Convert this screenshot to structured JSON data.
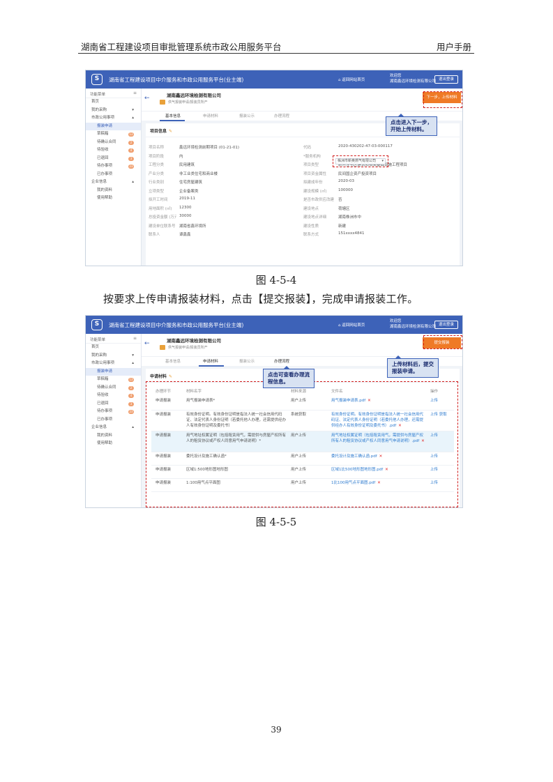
{
  "header": {
    "title": "湖南省工程建设项目审批管理系统市政公用服务平台",
    "manual": "用户手册"
  },
  "app": {
    "logo": "S",
    "title": "湖南省工程建设项目中介服务和市政公用服务平台(业主端)",
    "return_label": "返回网站首页",
    "welcome": "欢迎您",
    "user": "湖南鑫远环境检测有限公司",
    "exit_label": "退出登录",
    "menu_title": "功能菜单",
    "menu_icon": "≡",
    "company": "湖南鑫远环境检测有限公司",
    "company_sub": "供气报装申请/报装员所产",
    "back_arrow": "←"
  },
  "sidebar": {
    "items": [
      {
        "label": "首页",
        "type": "top"
      },
      {
        "label": "我的采购",
        "type": "top",
        "arrow": "▾"
      },
      {
        "label": "市政公用事项",
        "type": "top",
        "arrow": "▴"
      },
      {
        "label": "报装申请",
        "type": "sub",
        "active": true
      },
      {
        "label": "草稿箱",
        "type": "sub",
        "badge": "13"
      },
      {
        "label": "待确认合同",
        "type": "sub",
        "badge": "2"
      },
      {
        "label": "待验收",
        "type": "sub",
        "badge": "4"
      },
      {
        "label": "已退回",
        "type": "sub",
        "badge": "3"
      },
      {
        "label": "待办事项",
        "type": "sub",
        "badge": "23"
      },
      {
        "label": "已办事项",
        "type": "sub"
      },
      {
        "label": "企业信息",
        "type": "top",
        "arrow": "▴"
      },
      {
        "label": "我的资料",
        "type": "sub"
      },
      {
        "label": "使用帮助",
        "type": "sub"
      }
    ]
  },
  "shot1": {
    "button": "下一步，上传材料",
    "tabs": [
      "基本信息",
      "申请材料",
      "报装公示",
      "办理流程"
    ],
    "section": "项目信息",
    "pen": "✎",
    "left_fields": [
      {
        "label": "项目名称",
        "value": "鑫远环境检测前期项目 (01-21-01)"
      },
      {
        "label": "项目阶段",
        "value": "内"
      },
      {
        "label": "工程分类",
        "value": "民用建筑"
      },
      {
        "label": "产业分类",
        "value": "非工业类住宅和商业楼"
      },
      {
        "label": "行业类别",
        "value": "住宅房屋建筑"
      },
      {
        "label": "立项类型",
        "value": "企业备案类"
      },
      {
        "label": "拟开工时间",
        "value": "2019-11"
      },
      {
        "label": "用地面积 (㎡)",
        "value": "12300"
      },
      {
        "label": "总投资金额 (万元)",
        "value": "30000"
      },
      {
        "label": "建设单位联系号",
        "value": "湖南省鑫环境所"
      },
      {
        "label": "联系人",
        "value": "谭鑫鑫"
      }
    ],
    "right_fields": [
      {
        "label": "代码",
        "value": "2020-430202-47-03-000117"
      },
      {
        "label": "*服务机构",
        "value": "株洲市新奥燃气有限公司"
      },
      {
        "label": "项目类型",
        "value": "新兴住宅区建筑和相关基础设施工程项目"
      },
      {
        "label": "项目资金属性",
        "value": "民间国企资产投资项目"
      },
      {
        "label": "拟建成年份",
        "value": "2020-03"
      },
      {
        "label": "建设规模 (㎡)",
        "value": "100000"
      },
      {
        "label": "是否市政供应改建",
        "value": "否"
      },
      {
        "label": "建设地点",
        "value": "荷塘区"
      },
      {
        "label": "建设地点详细",
        "value": "湖南株洲市中"
      },
      {
        "label": "建设性质",
        "value": "新建"
      },
      {
        "label": "联系方式",
        "value": "151xxxx4841"
      }
    ],
    "select_arrow": "▾",
    "callout": [
      "点击进入下一步，",
      "开始上传材料。"
    ]
  },
  "caption1": "图 4-5-4",
  "body_text": "按要求上传申请报装材料，点击【提交报装】，完成申请报装工作。",
  "shot2": {
    "button": "提交报装",
    "tabs": [
      "基本信息",
      "申请材料",
      "报装公示",
      "办理流程"
    ],
    "section": "申请材料",
    "pen": "✎",
    "callout_flow": [
      "点击可查看办理流",
      "程信息。"
    ],
    "callout_upload": [
      "上传材料后，提交",
      "报装申请。"
    ],
    "headers": [
      "办理环节",
      "材料名字",
      "材料来源",
      "文件名",
      "操作"
    ],
    "rows": [
      {
        "step": "申请报装",
        "name": "用气报装申请表*",
        "source": "用户上传",
        "file": "用气报装申请表.pdf",
        "op": "上传"
      },
      {
        "step": "申请报装",
        "name": "有效身份证明。有效身份证明是指法人统一社会信用代码证、法定代表人身份证明（若委托他人办理，还需提供经办人有效身份证明及委托书）",
        "source": "系统获取",
        "file": "有效身份证明。有效身份证明是指法人统一社会信用代码证、法定代表人身份证明（若委托他人办理，还需提供经办人有效身份证明及委托书）.pdf",
        "op": "上传 获取"
      },
      {
        "step": "申请报装",
        "name": "用气地址权属证明（包括租赁用气，需提供与房屋产权所有人的租赁协议或产权人同意用气申请说明）*",
        "source": "用户上传",
        "file": "用气地址权属证明（包括租赁用气，需提供与房屋产权所有人的租赁协议或产权人同意用气申请说明）.pdf",
        "op": "上传"
      },
      {
        "step": "申请报装",
        "name": "委托设计及施工确认函*",
        "source": "用户上传",
        "file": "委托设计及施工确认函.pdf",
        "op": "上传"
      },
      {
        "step": "申请报装",
        "name": "区域1:500地形图地形图",
        "source": "用户上传",
        "file": "区域1比500地形图地形图.pdf",
        "op": "上传"
      },
      {
        "step": "申请报装",
        "name": "1:100用气点平面图",
        "source": "用户上传",
        "file": "1比100用气点平面图.pdf",
        "op": "上传"
      }
    ],
    "remove": "✕"
  },
  "caption2": "图 4-5-5",
  "page_number": "39"
}
